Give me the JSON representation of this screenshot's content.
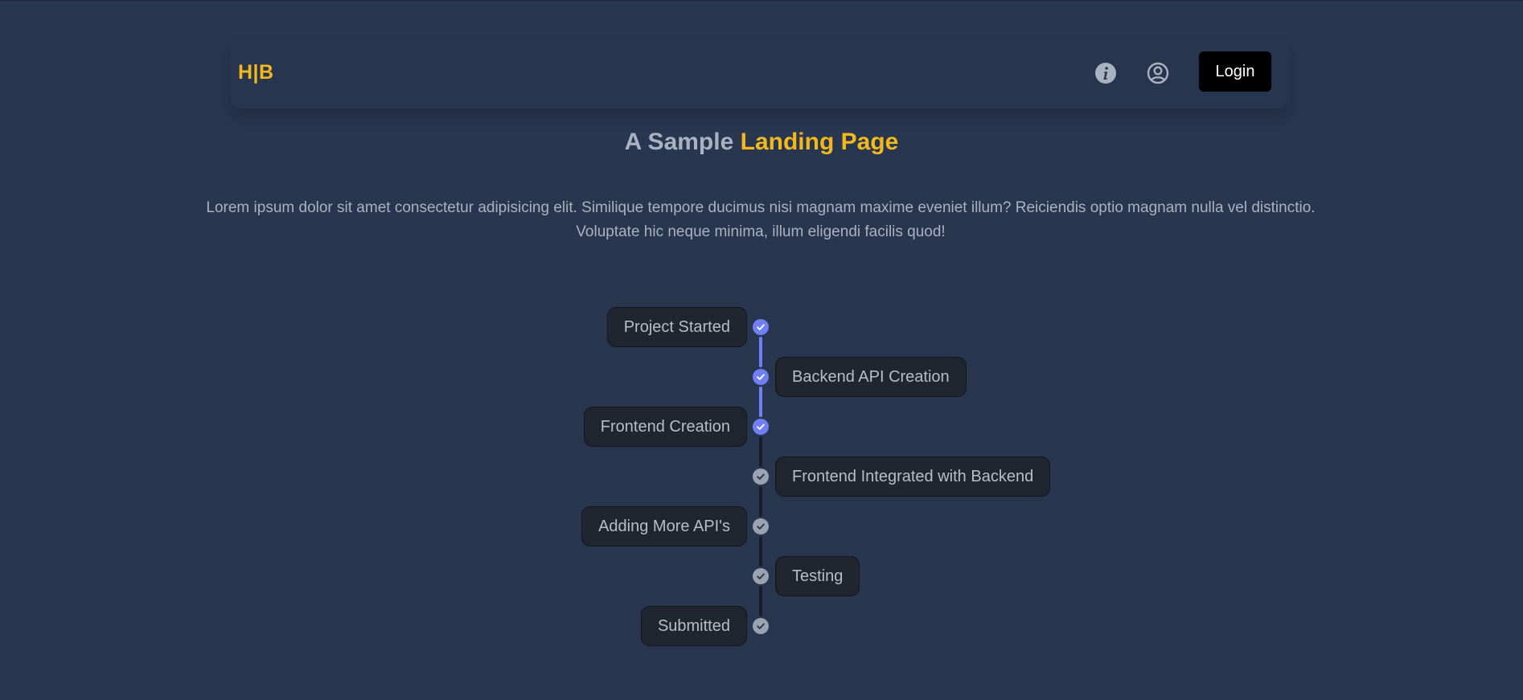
{
  "navbar": {
    "logo": "H|B",
    "info_icon": "info-icon",
    "user_icon": "user-circle-icon",
    "login_label": "Login"
  },
  "hero": {
    "title_prefix": "A Sample",
    "title_accent": "Landing Page",
    "paragraph": "Lorem ipsum dolor sit amet consectetur adipisicing elit. Similique tempore ducimus nisi magnam maxime eveniet illum? Reiciendis optio magnam nulla vel distinctio. Voluptate hic neque minima, illum eligendi facilis quod!"
  },
  "timeline": {
    "steps": [
      {
        "label": "Project Started",
        "side": "left",
        "completed": true
      },
      {
        "label": "Backend API Creation",
        "side": "right",
        "completed": true
      },
      {
        "label": "Frontend Creation",
        "side": "left",
        "completed": true
      },
      {
        "label": "Frontend Integrated with Backend",
        "side": "right",
        "completed": false
      },
      {
        "label": "Adding More API's",
        "side": "left",
        "completed": false
      },
      {
        "label": "Testing",
        "side": "right",
        "completed": false
      },
      {
        "label": "Submitted",
        "side": "left",
        "completed": false
      }
    ],
    "check_icon": "check-icon"
  },
  "colors": {
    "background": "#283650",
    "accent": "#f2b81e",
    "completed": "#6f7ff4",
    "pending": "#9aa3b0",
    "card": "#20252f",
    "connector_pending": "#1a1f27"
  }
}
